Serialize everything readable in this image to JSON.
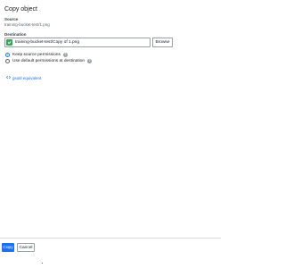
{
  "dialog": {
    "title": "Copy object",
    "source": {
      "label": "Source",
      "value": "training-bucket-test/1.png"
    },
    "destination": {
      "label": "Destination",
      "value": "training-bucket-test/Copy of 1.png",
      "browse_label": "Browse"
    },
    "permissions": {
      "options": [
        {
          "label": "Keep source permissions",
          "selected": true
        },
        {
          "label": "Use default permissions at destination",
          "selected": false
        }
      ]
    },
    "gsutil_link": "gsutil equivalent"
  },
  "footer": {
    "copy_label": "Copy",
    "cancel_label": "Cancel"
  },
  "colors": {
    "primary": "#1a73e8",
    "valid_check": "#34a853"
  }
}
